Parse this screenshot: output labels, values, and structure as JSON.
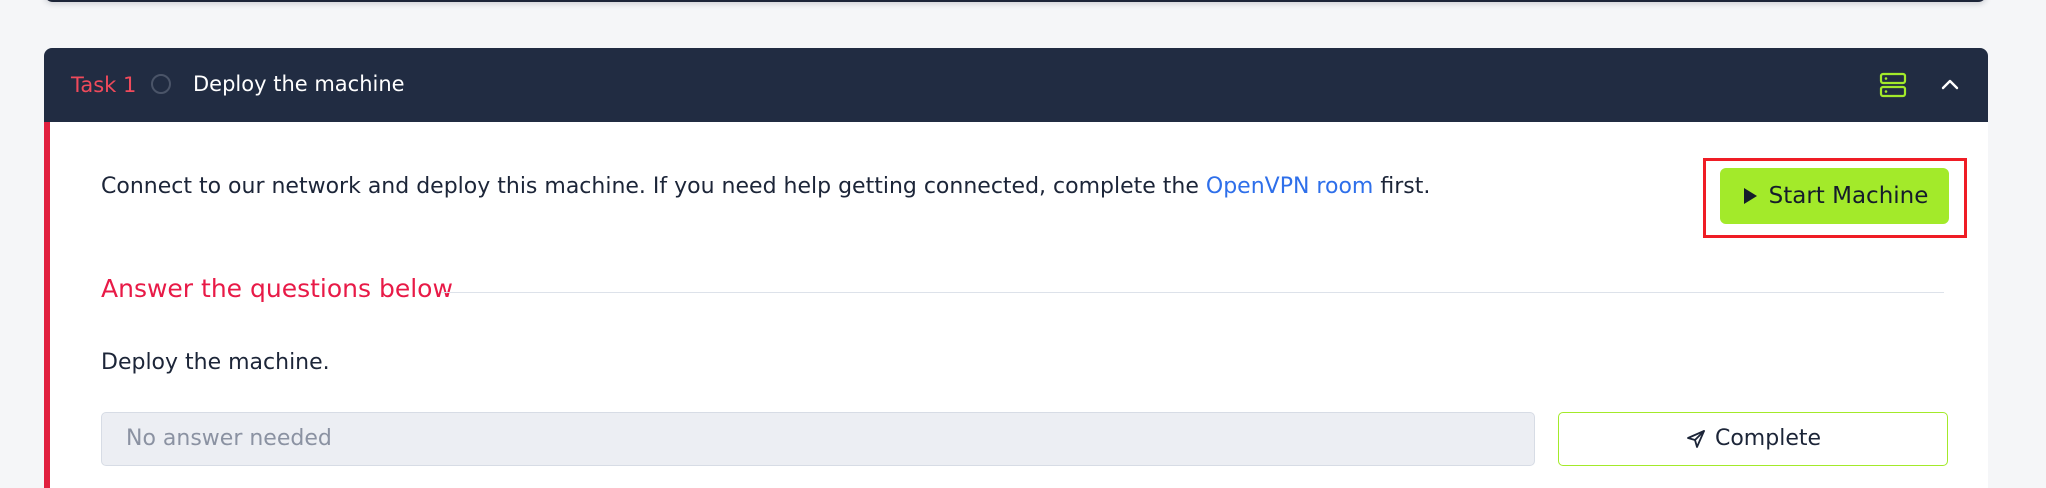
{
  "task": {
    "label": "Task 1",
    "title": "Deploy the machine",
    "intro": {
      "before_link": "Connect to our network and deploy this machine. If you need help getting connected, complete the ",
      "link_text": "OpenVPN room",
      "after_link": " first."
    },
    "start_machine_label": "Start Machine",
    "questions_heading": "Answer the questions below",
    "question": "Deploy the machine.",
    "answer_placeholder": "No answer needed",
    "complete_label": "Complete"
  },
  "icons": {
    "status": "circle-status-icon",
    "server": "server-icon",
    "collapse": "chevron-up-icon",
    "play": "play-icon",
    "submit": "send-icon"
  },
  "colors": {
    "header_background": "#212c42",
    "task_label": "#f04a5b",
    "accent_green": "#a3ea2a",
    "link": "#2e6fea",
    "section_heading": "#e81a47",
    "highlight_border": "#ef1d25",
    "body_border": "#e1203f"
  }
}
